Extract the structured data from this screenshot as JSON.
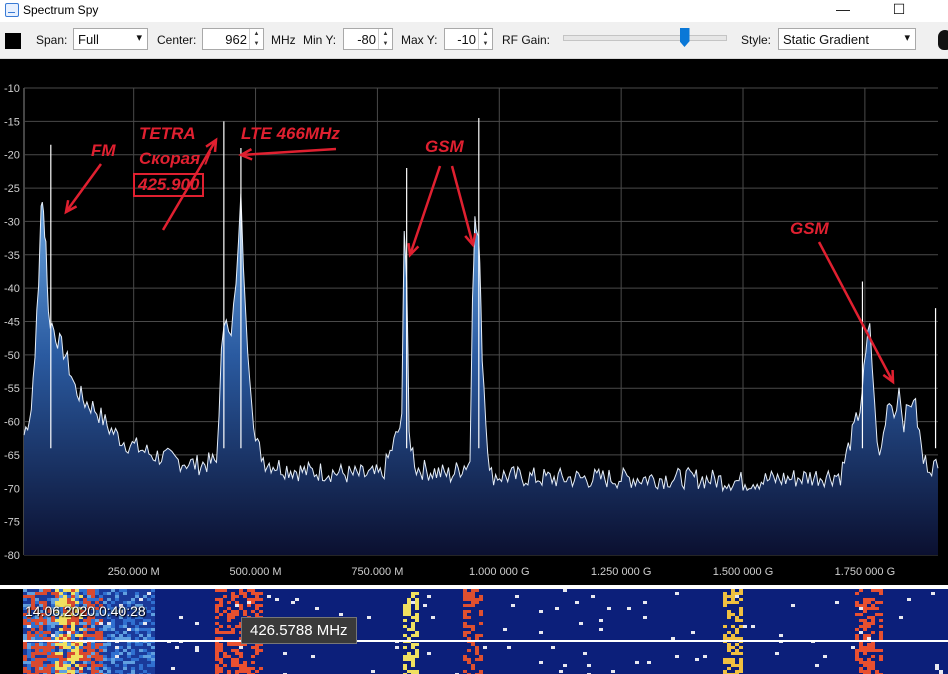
{
  "window": {
    "title": "Spectrum Spy",
    "minimize": "—",
    "maximize": "☐"
  },
  "toolbar": {
    "span_label": "Span:",
    "span_value": "Full",
    "center_label": "Center:",
    "center_value": "962",
    "center_unit": "MHz",
    "miny_label": "Min Y:",
    "miny_value": "-80",
    "maxy_label": "Max Y:",
    "maxy_value": "-10",
    "rfgain_label": "RF Gain:",
    "rfgain_level": 0.75,
    "style_label": "Style:",
    "style_value": "Static Gradient"
  },
  "chart_data": {
    "type": "area",
    "xlabel": "",
    "ylabel": "",
    "xlim": [
      25,
      1900
    ],
    "ylim": [
      -80,
      -10
    ],
    "grid": true,
    "x_ticks": [
      {
        "value": 250,
        "label": "250.000 M"
      },
      {
        "value": 500,
        "label": "500.000 M"
      },
      {
        "value": 750,
        "label": "750.000 M"
      },
      {
        "value": 1000,
        "label": "1.000 000 G"
      },
      {
        "value": 1250,
        "label": "1.250 000 G"
      },
      {
        "value": 1500,
        "label": "1.500 000 G"
      },
      {
        "value": 1750,
        "label": "1.750 000 G"
      }
    ],
    "y_ticks": [
      -10,
      -15,
      -20,
      -25,
      -30,
      -35,
      -40,
      -45,
      -50,
      -55,
      -60,
      -65,
      -70,
      -75,
      -80
    ],
    "series": [
      {
        "x": [
          25,
          40,
          55,
          60,
          65,
          70,
          75,
          90,
          110,
          130,
          150,
          170,
          200,
          230,
          260,
          290,
          320,
          350,
          380,
          420,
          430,
          440,
          450,
          460,
          470,
          480,
          500,
          520,
          560,
          600,
          650,
          700,
          760,
          800,
          805,
          810,
          815,
          830,
          900,
          940,
          945,
          950,
          955,
          960,
          965,
          980,
          1100,
          1200,
          1300,
          1400,
          1500,
          1600,
          1700,
          1740,
          1760,
          1770,
          1780,
          1800,
          1810,
          1820,
          1830,
          1840,
          1850,
          1870,
          1900
        ],
        "y": [
          -62,
          -58,
          -40,
          -27,
          -29,
          -33,
          -44,
          -47,
          -50,
          -55,
          -57,
          -58,
          -61,
          -63,
          -64,
          -65,
          -65.5,
          -66,
          -66.5,
          -66,
          -50,
          -44,
          -46,
          -40,
          -27,
          -45,
          -63,
          -66,
          -67,
          -67.5,
          -67.5,
          -68,
          -68,
          -60,
          -30,
          -39,
          -62,
          -67,
          -68,
          -66,
          -40,
          -30,
          -32,
          -35,
          -50,
          -68,
          -68.5,
          -68.5,
          -68.5,
          -68.5,
          -69,
          -68.5,
          -68,
          -58,
          -45,
          -58,
          -66,
          -56,
          -59,
          -55,
          -60,
          -58,
          -56,
          -66,
          -67
        ]
      }
    ],
    "peaks": [
      {
        "x": 80,
        "y": -18.5
      },
      {
        "x": 435,
        "y": -15
      },
      {
        "x": 470,
        "y": -19
      },
      {
        "x": 810,
        "y": -22
      },
      {
        "x": 958,
        "y": -14.5
      },
      {
        "x": 1745,
        "y": -39
      },
      {
        "x": 1895,
        "y": -43
      }
    ]
  },
  "annotations": {
    "fm": "FM",
    "tetra": "TETRA",
    "skoraya": "Скорая /",
    "freq": "425.900",
    "lte": "LTE 466MHz",
    "gsm1": "GSM",
    "gsm2": "GSM"
  },
  "waterfall": {
    "timestamp": "14.06.2020 0:40:28",
    "cursor_freq": "426.5788 MHz"
  },
  "colors": {
    "accent": "#e02030",
    "trace": "#ffffff",
    "fill_top": "#4a86c8",
    "fill_bottom": "#0b1030",
    "slider": "#0a78d7"
  }
}
